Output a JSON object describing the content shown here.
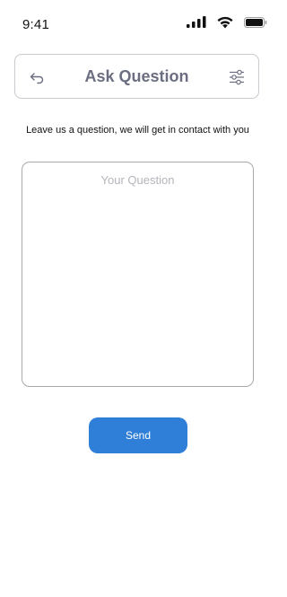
{
  "status_bar": {
    "time": "9:41",
    "icons": [
      "signal-icon",
      "wifi-icon",
      "battery-icon"
    ]
  },
  "header": {
    "title": "Ask Question",
    "left_icon": "back-arrow-icon",
    "right_icon": "filter-sliders-icon"
  },
  "intro": {
    "text": "Leave us a question, we will get in contact with you"
  },
  "question": {
    "placeholder": "Your Question",
    "value": ""
  },
  "send": {
    "label": "Send"
  },
  "colors": {
    "accent": "#2f7fd8",
    "title": "#6b6d80",
    "border": "#c9c9cf",
    "placeholder": "#b4b4bb"
  }
}
